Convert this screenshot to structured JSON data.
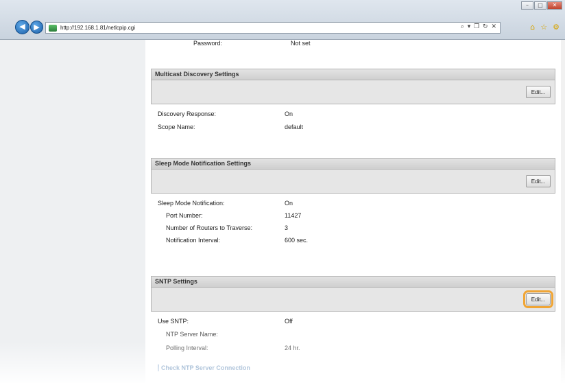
{
  "browser": {
    "url": "http://192.168.1.81/netlcpip.cgi",
    "address_tools": "⌕ ▾ ❐ ↻ ✕",
    "window_controls": [
      "–",
      "□",
      "✕"
    ],
    "toolbar_icons": [
      "home-icon",
      "star-icon",
      "gear-icon"
    ]
  },
  "top_row": {
    "label": "Password:",
    "value": "Not set"
  },
  "multicast": {
    "title": "Multicast Discovery Settings",
    "edit_label": "Edit...",
    "rows": [
      {
        "label": "Discovery Response:",
        "value": "On"
      },
      {
        "label": "Scope Name:",
        "value": "default"
      }
    ]
  },
  "sleep": {
    "title": "Sleep Mode Notification Settings",
    "edit_label": "Edit...",
    "rows": [
      {
        "label": "Sleep Mode Notification:",
        "value": "On"
      },
      {
        "label": "Port Number:",
        "value": "11427"
      },
      {
        "label": "Number of Routers to Traverse:",
        "value": "3"
      },
      {
        "label": "Notification Interval:",
        "value": "600 sec."
      }
    ]
  },
  "sntp": {
    "title": "SNTP Settings",
    "edit_label": "Edit...",
    "rows": [
      {
        "label": "Use SNTP:",
        "value": "Off"
      },
      {
        "label": "NTP Server Name:",
        "value": ""
      },
      {
        "label": "Polling Interval:",
        "value": "24 hr."
      }
    ],
    "link": "Check NTP Server Connection"
  },
  "colors": {
    "highlight": "#f0a535",
    "section_header": "#d9d9d9",
    "link": "#3a6ea5"
  }
}
